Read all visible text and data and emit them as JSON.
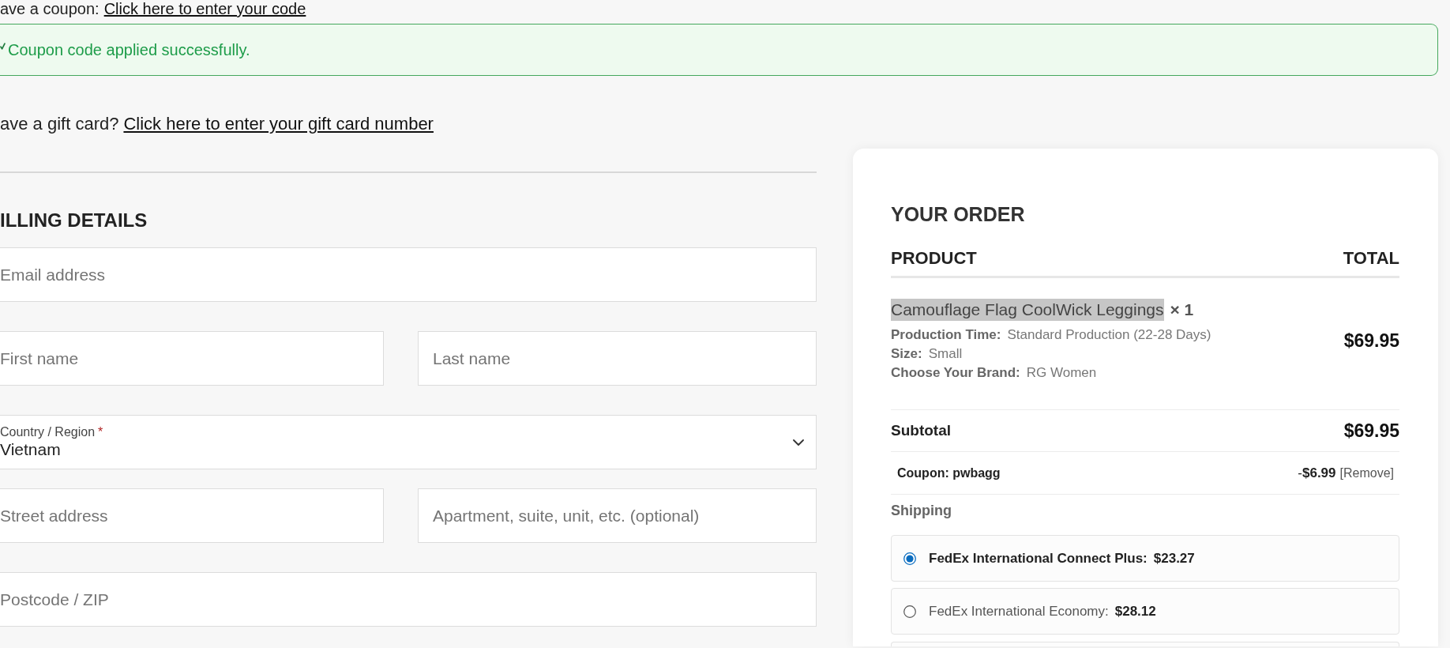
{
  "coupon_prompt": {
    "text": "ave a coupon:",
    "link": "Click here to enter your code"
  },
  "notice": {
    "kind": "success",
    "message": "Coupon code applied successfully."
  },
  "gift_card_prompt": {
    "text": "ave a gift card?",
    "link": "Click here to enter your gift card number"
  },
  "billing": {
    "title": "ILLING DETAILS",
    "rows": [
      [
        {
          "kind": "text",
          "placeholder": "Email address"
        }
      ],
      [
        {
          "kind": "text",
          "placeholder": "First name"
        },
        {
          "kind": "text",
          "placeholder": "Last name"
        }
      ],
      [
        {
          "kind": "select",
          "label": "Country / Region",
          "required_mark": "*",
          "value": "Vietnam"
        }
      ],
      [
        {
          "kind": "text",
          "placeholder": "Street address"
        },
        {
          "kind": "text",
          "placeholder": "Apartment, suite, unit, etc. (optional)"
        }
      ],
      [
        {
          "kind": "text",
          "placeholder": "Postcode / ZIP"
        }
      ]
    ]
  },
  "order": {
    "title": "YOUR ORDER",
    "columns": [
      "PRODUCT",
      "TOTAL"
    ],
    "items": [
      {
        "name": "Camouflage Flag CoolWick Leggings",
        "highlighted": true,
        "quantity": "× 1",
        "options": [
          {
            "label": "Production Time:",
            "value": "Standard Production (22-28 Days)"
          },
          {
            "label": "Size:",
            "value": "Small"
          },
          {
            "label": "Choose Your Brand:",
            "value": "RG Women"
          }
        ],
        "total": "$69.95"
      }
    ],
    "subtotal": {
      "label": "Subtotal",
      "value": "$69.95"
    },
    "coupons": [
      {
        "label": "Coupon: pwbagg",
        "amount": "-**$6.99**",
        "remove": "[Remove]"
      }
    ],
    "shipping": {
      "label": "Shipping",
      "options": [
        {
          "name": "FedEx International Connect Plus:",
          "price": "$23.27",
          "selected": true
        },
        {
          "name": "FedEx International Economy:",
          "price": "$28.12",
          "selected": false
        }
      ],
      "partial_option_below": true
    }
  }
}
